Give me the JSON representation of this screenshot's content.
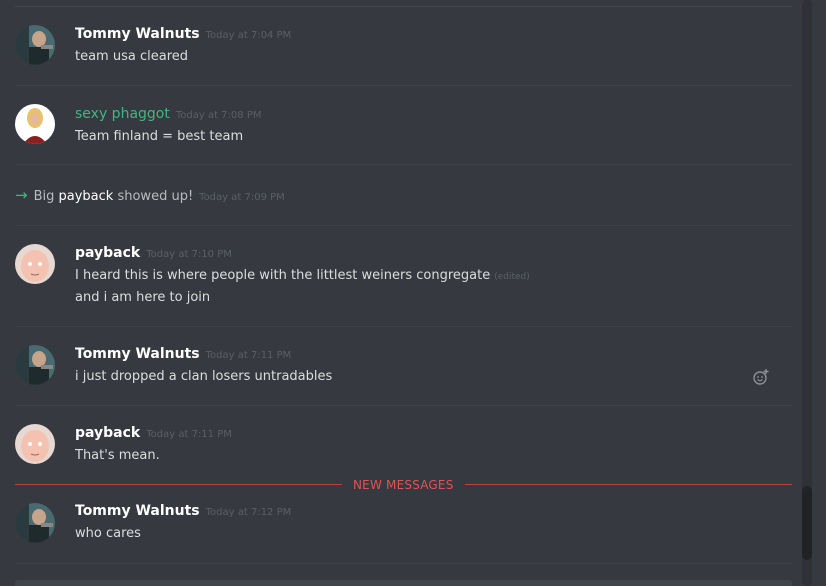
{
  "messages": [
    {
      "author": "Tommy Walnuts",
      "timestamp": "Today at 7:04 PM",
      "lines": [
        "team usa cleared"
      ]
    },
    {
      "author": "sexy phaggot",
      "timestamp": "Today at 7:08 PM",
      "lines": [
        "Team finland = best team"
      ],
      "author_color": "#43b581"
    },
    {
      "author": "payback",
      "timestamp": "Today at 7:10 PM",
      "lines": [
        "I heard this is where people with the littlest weiners congregate",
        "and i am here to join"
      ],
      "edited": "(edited)"
    },
    {
      "author": "Tommy Walnuts",
      "timestamp": "Today at 7:11 PM",
      "lines": [
        "i just dropped a clan losers untradables"
      ]
    },
    {
      "author": "payback",
      "timestamp": "Today at 7:11 PM",
      "lines": [
        "That's mean."
      ]
    },
    {
      "author": "Tommy Walnuts",
      "timestamp": "Today at 7:12 PM",
      "lines": [
        "who cares"
      ]
    }
  ],
  "system": {
    "prefix": "Big",
    "user": "payback",
    "suffix": "showed up!",
    "timestamp": "Today at 7:09 PM"
  },
  "new_messages_label": "NEW MESSAGES",
  "colors": {
    "background": "#36393f",
    "accent_green": "#43b581",
    "new_messages_red": "#e05454"
  }
}
